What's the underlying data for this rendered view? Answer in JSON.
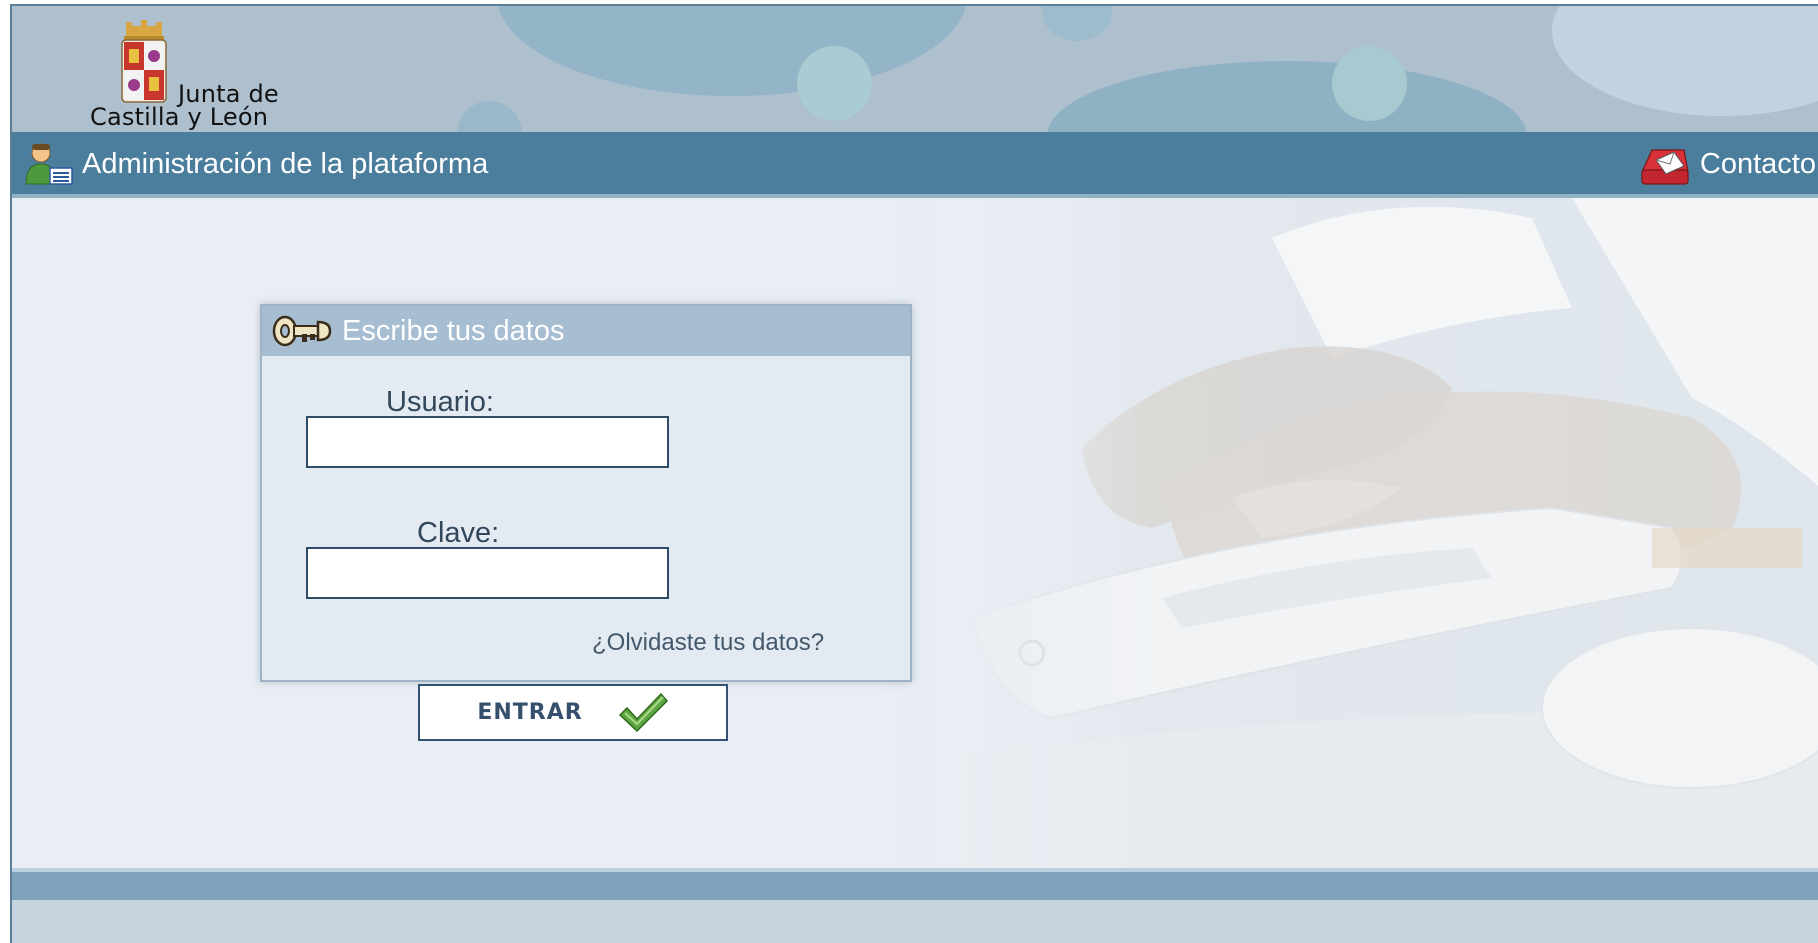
{
  "header": {
    "logo_line1": "Junta de",
    "logo_line2": "Castilla y León"
  },
  "navbar": {
    "title": "Administración de la plataforma",
    "title_icon": "admin-user-icon",
    "contact_label": "Contacto",
    "contact_icon": "contact-mail-icon"
  },
  "login": {
    "panel_title": "Escribe tus datos",
    "panel_icon": "key-icon",
    "user_label": "Usuario:",
    "user_value": "",
    "password_label": "Clave:",
    "password_value": "",
    "forgot_link": "¿Olvidaste tus datos?",
    "submit_label": "ENTRAR",
    "submit_icon": "checkmark-icon"
  },
  "colors": {
    "navbar": "#4a7e9c",
    "panel_header": "#a7bdd2",
    "accent_check": "#5fa640"
  }
}
